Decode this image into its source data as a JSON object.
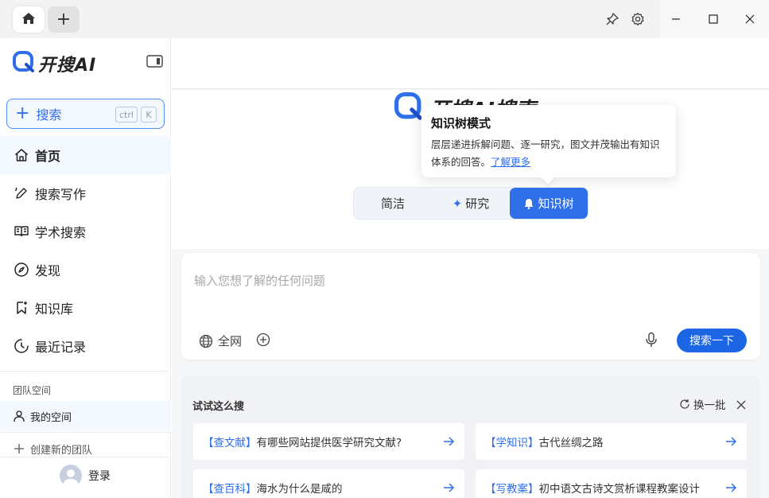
{
  "titlebar": {
    "home_icon": "home-icon",
    "new_tab_label": "+",
    "pin_icon": "pin-icon",
    "settings_icon": "gear-icon"
  },
  "sidebar": {
    "logo_text": "开搜AI",
    "search_label": "搜索",
    "shortcut_ctrl": "ctrl",
    "shortcut_key": "K",
    "nav": [
      {
        "label": "首页",
        "icon": "home-icon"
      },
      {
        "label": "搜索写作",
        "icon": "pen-icon"
      },
      {
        "label": "学术搜索",
        "icon": "book-icon"
      },
      {
        "label": "发现",
        "icon": "compass-icon"
      },
      {
        "label": "知识库",
        "icon": "bookmark-icon"
      },
      {
        "label": "最近记录",
        "icon": "history-icon"
      }
    ],
    "team_section": "团队空间",
    "my_space": "我的空间",
    "create_team": "创建新的团队",
    "login": "登录"
  },
  "main": {
    "brand": "开搜AI搜索",
    "tooltip": {
      "title": "知识树模式",
      "desc": "层层递进拆解问题、逐一研究，图文并茂输出有知识体系的回答。",
      "link": "了解更多"
    },
    "modes": [
      "简洁",
      "研究",
      "知识树"
    ],
    "active_mode": "知识树",
    "input_placeholder": "输入您想了解的任何问题",
    "scope_label": "全网",
    "send_label": "搜索一下",
    "suggest": {
      "title": "试试这么搜",
      "refresh": "换一批",
      "items": [
        {
          "tag": "【查文献】",
          "text": "有哪些网站提供医学研究文献?"
        },
        {
          "tag": "【学知识】",
          "text": "古代丝绸之路"
        },
        {
          "tag": "【查百科】",
          "text": "海水为什么是咸的"
        },
        {
          "tag": "【写教案】",
          "text": "初中语文古诗文赏析课程教案设计"
        }
      ]
    }
  },
  "colors": {
    "accent": "#2f6fe8",
    "send": "#1c66e5"
  }
}
